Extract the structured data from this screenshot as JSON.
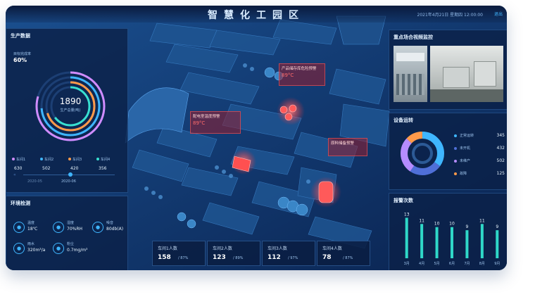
{
  "header": {
    "title": "智慧化工园区",
    "datetime": "2021年4月21日 星期四  12:00:00",
    "exit_label": "退出"
  },
  "production": {
    "panel_title": "生产数据",
    "target_label": "目标完成率",
    "target_value": "60%",
    "total_value": "1890",
    "total_label": "生产总量(吨)",
    "workshops": [
      {
        "name": "车间1",
        "value": "630",
        "color": "#d08cff"
      },
      {
        "name": "车间2",
        "value": "502",
        "color": "#3fb6ff"
      },
      {
        "name": "车间3",
        "value": "420",
        "color": "#ff9a4a"
      },
      {
        "name": "车间4",
        "value": "356",
        "color": "#38e0d0"
      }
    ],
    "timeline": [
      "2020-05",
      "2020-06"
    ]
  },
  "environment": {
    "panel_title": "环境检测",
    "items": [
      {
        "label": "温度",
        "value": "18℃",
        "icon": "thermometer-icon"
      },
      {
        "label": "湿度",
        "value": "70%RH",
        "icon": "humidity-icon"
      },
      {
        "label": "噪音",
        "value": "80db(A)",
        "icon": "noise-icon"
      },
      {
        "label": "雨水",
        "value": "320m³/a",
        "icon": "rain-icon"
      },
      {
        "label": "粉尘",
        "value": "0.7mg/m³",
        "icon": "dust-icon"
      }
    ]
  },
  "monitor": {
    "panel_title": "重点场合视频监控"
  },
  "equipment": {
    "panel_title": "设备运转",
    "items": [
      {
        "label": "正常运转",
        "value": "345",
        "color": "#3fb6ff"
      },
      {
        "label": "未开机",
        "value": "432",
        "color": "#4f6fd8"
      },
      {
        "label": "未维产",
        "value": "502",
        "color": "#b58cff"
      },
      {
        "label": "故障",
        "value": "125",
        "color": "#ff9a4a"
      }
    ]
  },
  "alarms": {
    "panel_title": "报警次数",
    "chart_data": {
      "type": "bar",
      "categories": [
        "3月",
        "4月",
        "5月",
        "6月",
        "7月",
        "8月",
        "9月"
      ],
      "values": [
        13,
        11,
        10,
        10,
        9,
        11,
        9
      ]
    }
  },
  "map_alerts": [
    {
      "label": "产品储存库危险预警",
      "value": "89°C"
    },
    {
      "label": "配电室温度预警",
      "value": "89°C"
    },
    {
      "label": "原料储备预警",
      "value": ""
    }
  ],
  "workshop_cards": [
    {
      "label": "车间1人数",
      "value": "158",
      "pct": "/ 87%"
    },
    {
      "label": "车间2人数",
      "value": "123",
      "pct": "/ 89%"
    },
    {
      "label": "车间3人数",
      "value": "112",
      "pct": "/ 97%"
    },
    {
      "label": "车间4人数",
      "value": "78",
      "pct": "/ 87%"
    }
  ],
  "colors": {
    "accent": "#3fb6ff",
    "alert": "#ff4b4b",
    "bg": "#0b1f45"
  }
}
